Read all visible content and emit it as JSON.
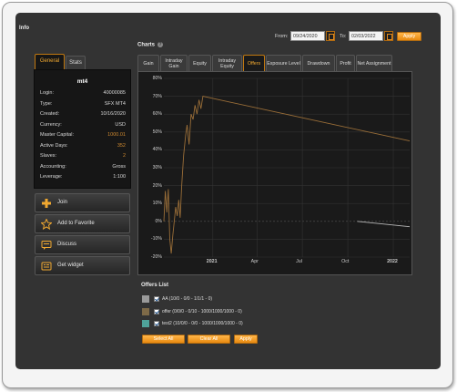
{
  "info": {
    "title": "Info",
    "tabs": [
      "General",
      "Stats"
    ],
    "account_name": "mt4",
    "rows": [
      {
        "key": "Login:",
        "value": "40000085",
        "highlight": false
      },
      {
        "key": "Type:",
        "value": "SFX MT4",
        "highlight": false
      },
      {
        "key": "Created:",
        "value": "10/16/2020",
        "highlight": false
      },
      {
        "key": "Currency:",
        "value": "USD",
        "highlight": false
      },
      {
        "key": "Master Capital:",
        "value": "1000.01",
        "highlight": true
      },
      {
        "key": "Active Days:",
        "value": "352",
        "highlight": true
      },
      {
        "key": "Slaves:",
        "value": "2",
        "highlight": true
      },
      {
        "key": "Accounting:",
        "value": "Gross",
        "highlight": false
      },
      {
        "key": "Leverage:",
        "value": "1:100",
        "highlight": false
      }
    ],
    "actions": [
      {
        "label": "Join",
        "icon": "plus-icon"
      },
      {
        "label": "Add to Favorite",
        "icon": "star-icon"
      },
      {
        "label": "Discuss",
        "icon": "chat-bubble-icon"
      },
      {
        "label": "Get widget",
        "icon": "widget-icon"
      }
    ]
  },
  "charts": {
    "title": "Charts",
    "help_icon": "help-icon",
    "date_range": {
      "from_label": "From:",
      "from_value": "09/24/2020",
      "to_label": "To:",
      "to_value": "02/03/2022",
      "apply_label": "Apply"
    },
    "tabs": [
      "Gain",
      "Intraday Gain",
      "Equity",
      "Intraday Equity",
      "Offers",
      "Exposure Level",
      "Drawdown",
      "Profit",
      "Net Assignment"
    ],
    "active_tab": "Offers"
  },
  "chart_data": {
    "type": "line",
    "ylim": [
      -10,
      80
    ],
    "y_ticks": [
      "80%",
      "70%",
      "60%",
      "50%",
      "40%",
      "30%",
      "20%",
      "10%",
      "0%",
      "-10%",
      "-20%"
    ],
    "x_ticks": [
      {
        "label": "2021",
        "bold": true
      },
      {
        "label": "Apr",
        "bold": false
      },
      {
        "label": "Jul",
        "bold": false
      },
      {
        "label": "Oct",
        "bold": false
      },
      {
        "label": "2022",
        "bold": true
      }
    ],
    "grid": true,
    "series": [
      {
        "name": "offer (0/0/0 - 0/10 - 1000/1000/1000 - 0)",
        "color": "#9a6e38",
        "points": [
          [
            "2020-09-24",
            0
          ],
          [
            "2020-09-27",
            17
          ],
          [
            "2020-09-30",
            5
          ],
          [
            "2020-10-03",
            18
          ],
          [
            "2020-10-06",
            -10
          ],
          [
            "2020-10-09",
            -18
          ],
          [
            "2020-10-12",
            -8
          ],
          [
            "2020-10-15",
            0
          ],
          [
            "2020-10-18",
            8
          ],
          [
            "2020-10-21",
            3
          ],
          [
            "2020-10-24",
            12
          ],
          [
            "2020-10-27",
            2
          ],
          [
            "2020-10-30",
            20
          ],
          [
            "2020-11-03",
            37
          ],
          [
            "2020-11-07",
            48
          ],
          [
            "2020-11-10",
            54
          ],
          [
            "2020-11-14",
            43
          ],
          [
            "2020-11-18",
            60
          ],
          [
            "2020-11-22",
            57
          ],
          [
            "2020-11-26",
            65
          ],
          [
            "2020-11-30",
            60
          ],
          [
            "2020-12-04",
            68
          ],
          [
            "2020-12-08",
            63
          ],
          [
            "2020-12-12",
            70
          ],
          [
            "2022-02-03",
            45
          ]
        ]
      },
      {
        "name": "test2 (10/0/0 - 0/0 - 1000/1000/1000 - 0)",
        "color": "#b8b8b8",
        "points": [
          [
            "2021-10-20",
            0
          ],
          [
            "2022-02-03",
            -3
          ]
        ]
      }
    ]
  },
  "offers": {
    "title": "Offers List",
    "items": [
      {
        "label": "AA (10/0 - 0/0 - 1/1/1 - 0)",
        "color": "#9a9a9a",
        "checked": true
      },
      {
        "label": "offer (0/0/0 - 0/10 - 1000/1000/1000 - 0)",
        "color": "#7e6a48",
        "checked": true
      },
      {
        "label": "test2 (10/0/0 - 0/0 - 1000/1000/1000 - 0)",
        "color": "#4fa39a",
        "checked": true
      }
    ],
    "buttons": {
      "select_all": "Select All",
      "clear_all": "Clear All",
      "apply": "Apply"
    }
  }
}
